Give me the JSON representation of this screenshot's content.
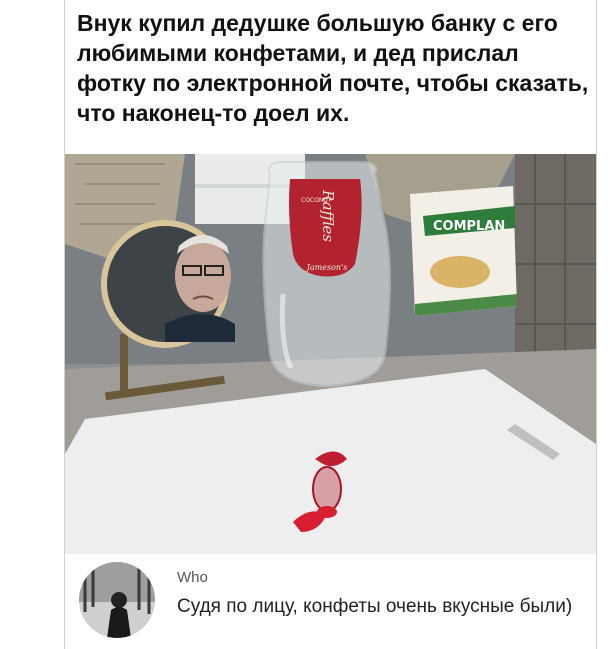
{
  "post": {
    "caption": "Внук купил дедушке большую банку с его любимыми конфетами, и дед прислал фотку по электронной почте, чтобы сказать, что наконец-то доел их."
  },
  "photo": {
    "jar_brand": "Jameson's",
    "jar_product": "Raffles",
    "jar_flavor": "COCONUT",
    "box_brand": "COMPLAN"
  },
  "comment": {
    "author": "Who",
    "text": "Судя по лицу, конфеты очень вкусные были)"
  }
}
